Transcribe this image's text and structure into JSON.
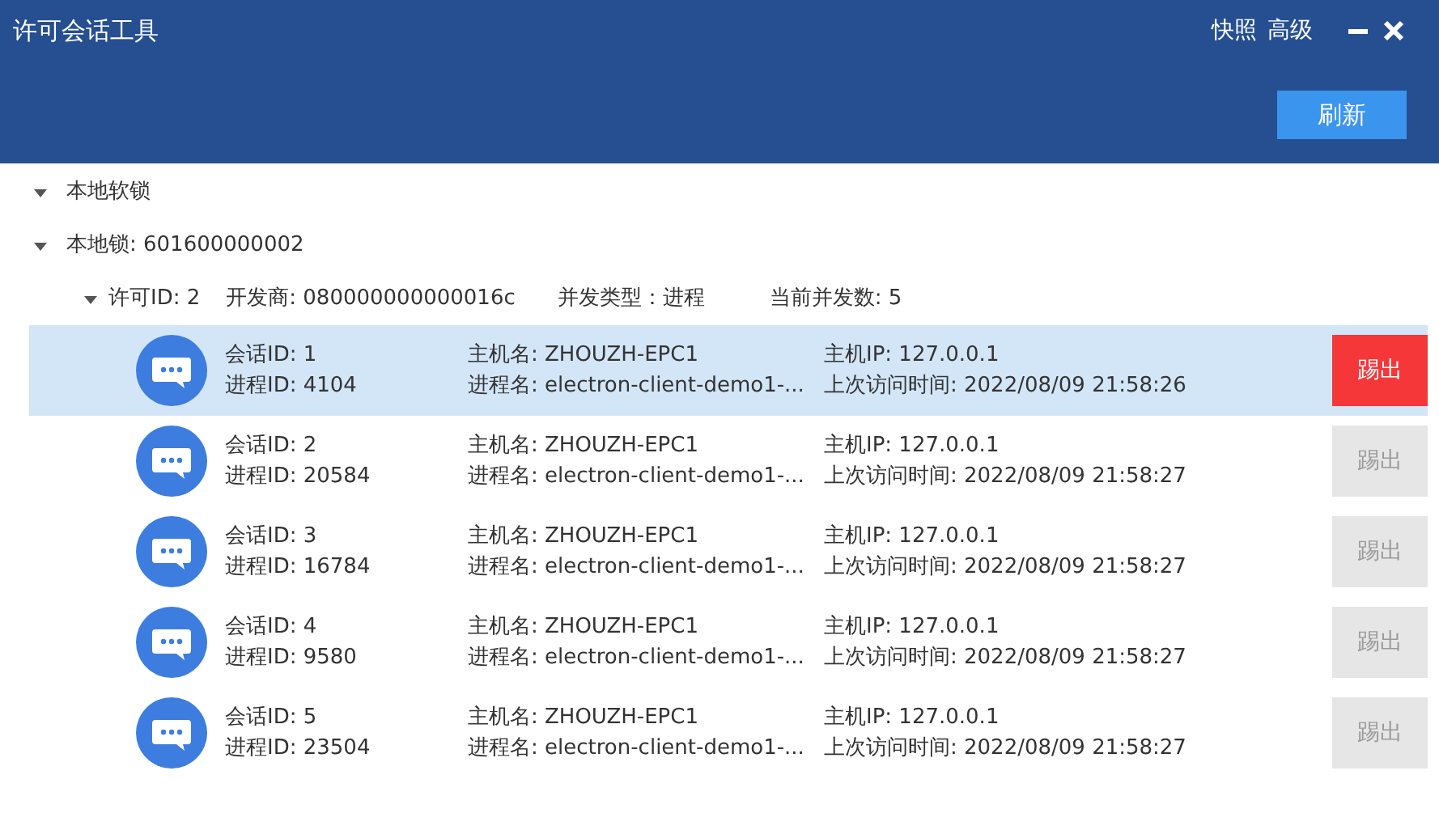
{
  "window": {
    "title": "许可会话工具",
    "menu": [
      "快照",
      "高级"
    ]
  },
  "toolbar": {
    "refresh_button": "刷新"
  },
  "tree": [
    {
      "label": "本地软锁",
      "expanded": true
    },
    {
      "label": "本地锁: 601600000002",
      "expanded": true,
      "children": [
        {
          "fields": [
            "许可ID: 2",
            "开发商: 080000000000016c",
            "并发类型：进程",
            "当前并发数: 5"
          ],
          "expanded": true,
          "sessions": [
            {
              "session_id": "会话ID: 1",
              "process_id": "进程ID: 4104",
              "host": "主机名: ZHOUZH-EPC1",
              "process_name": "进程名: electron-client-demo1-...",
              "ip": "主机IP: 127.0.0.1",
              "last_access": "上次访问时间: 2022/08/09 21:58:26",
              "selected": true,
              "kick": {
                "label": "踢出",
                "disabled": false
              }
            },
            {
              "session_id": "会话ID: 2",
              "process_id": "进程ID: 20584",
              "host": "主机名: ZHOUZH-EPC1",
              "process_name": "进程名: electron-client-demo1-...",
              "ip": "主机IP: 127.0.0.1",
              "last_access": "上次访问时间: 2022/08/09 21:58:27",
              "selected": false,
              "kick": {
                "label": "踢出",
                "disabled": true
              }
            },
            {
              "session_id": "会话ID: 3",
              "process_id": "进程ID: 16784",
              "host": "主机名: ZHOUZH-EPC1",
              "process_name": "进程名: electron-client-demo1-...",
              "ip": "主机IP: 127.0.0.1",
              "last_access": "上次访问时间: 2022/08/09 21:58:27",
              "selected": false,
              "kick": {
                "label": "踢出",
                "disabled": true
              }
            },
            {
              "session_id": "会话ID: 4",
              "process_id": "进程ID: 9580",
              "host": "主机名: ZHOUZH-EPC1",
              "process_name": "进程名: electron-client-demo1-...",
              "ip": "主机IP: 127.0.0.1",
              "last_access": "上次访问时间: 2022/08/09 21:58:27",
              "selected": false,
              "kick": {
                "label": "踢出",
                "disabled": true
              }
            },
            {
              "session_id": "会话ID: 5",
              "process_id": "进程ID: 23504",
              "host": "主机名: ZHOUZH-EPC1",
              "process_name": "进程名: electron-client-demo1-...",
              "ip": "主机IP: 127.0.0.1",
              "last_access": "上次访问时间: 2022/08/09 21:58:27",
              "selected": false,
              "kick": {
                "label": "踢出",
                "disabled": true
              }
            }
          ]
        }
      ]
    }
  ]
}
